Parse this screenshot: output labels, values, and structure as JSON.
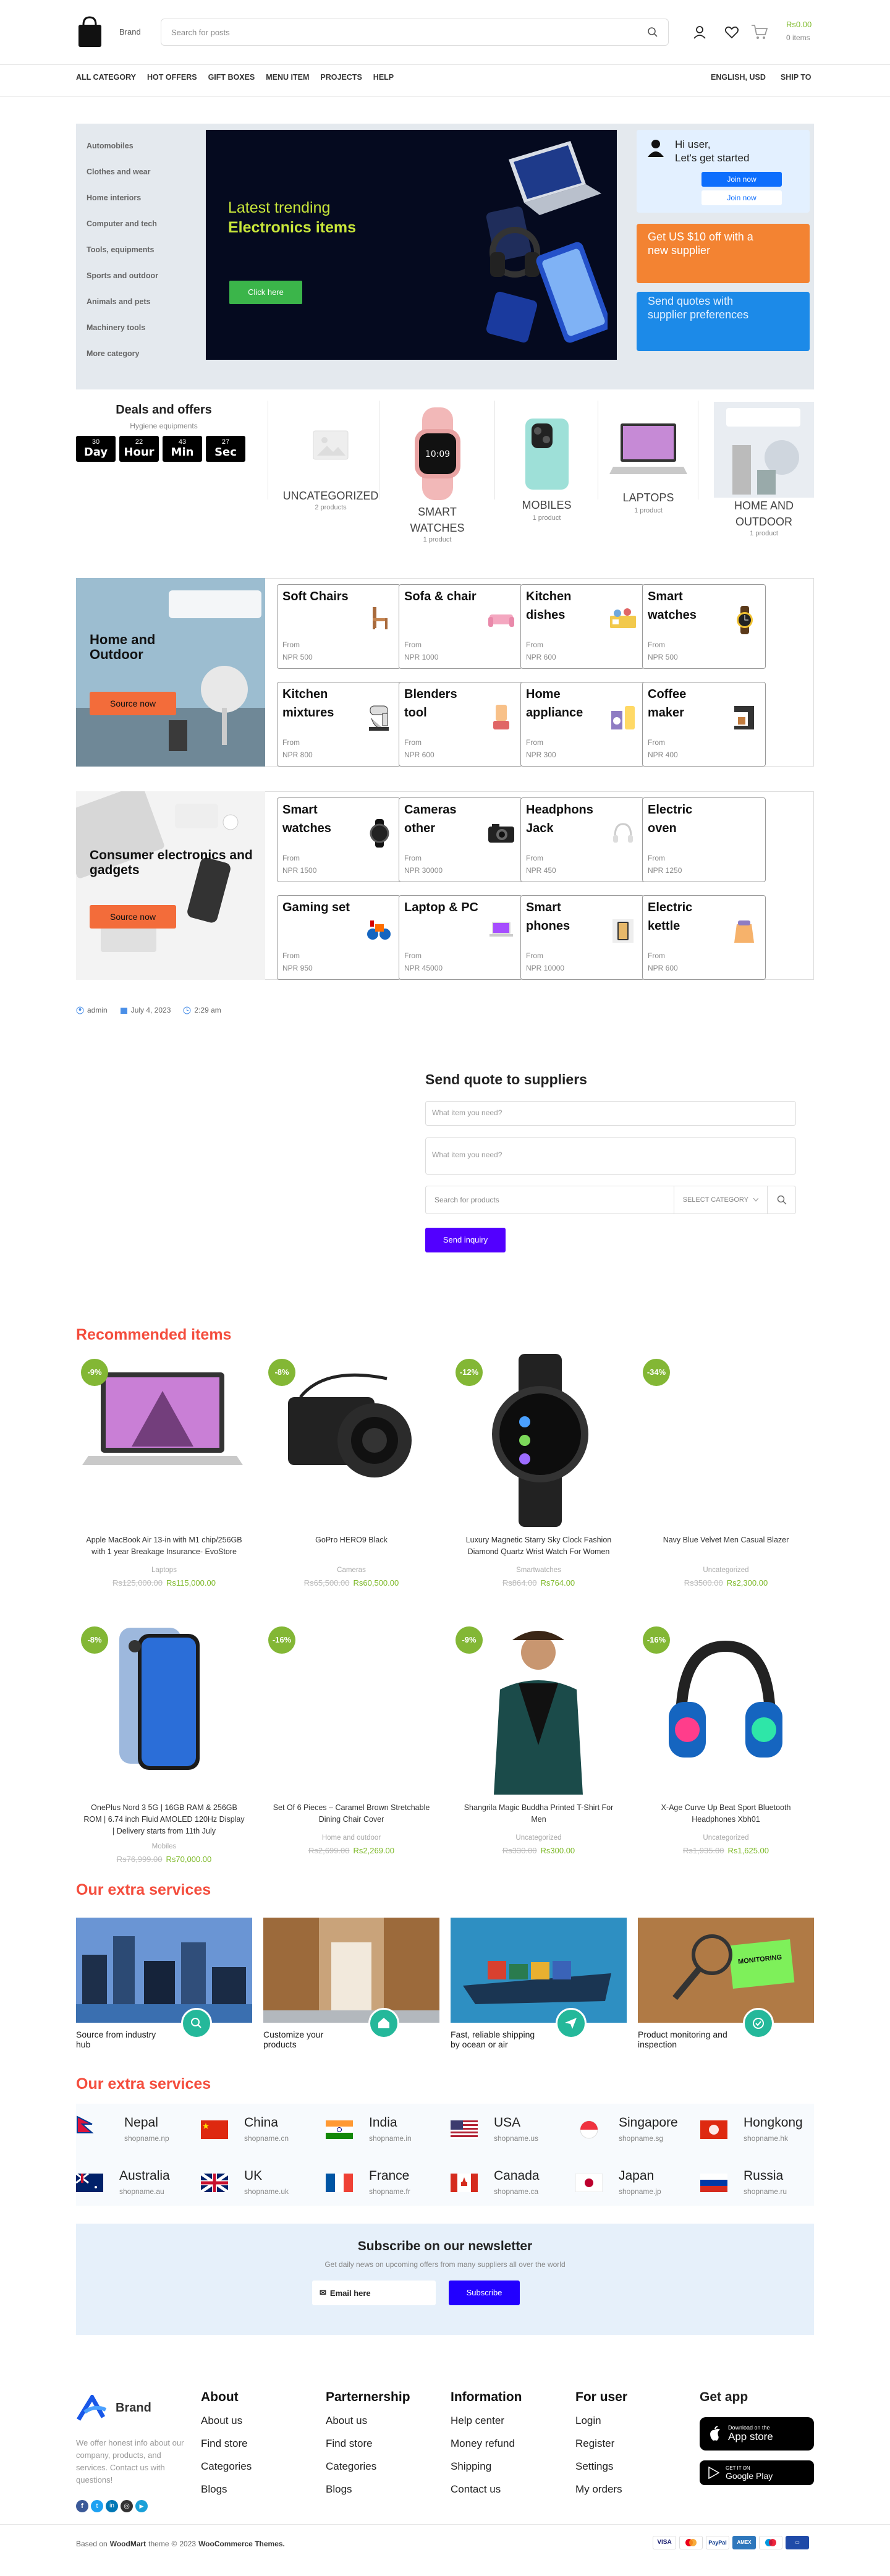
{
  "header": {
    "brand": "Brand",
    "search_placeholder": "Search for posts",
    "cart_price": "Rs0.00",
    "cart_items": "0 items"
  },
  "nav": {
    "items": [
      "ALL CATEGORY",
      "HOT OFFERS",
      "GIFT BOXES",
      "MENU ITEM",
      "PROJECTS",
      "HELP"
    ],
    "lang": "ENGLISH, USD",
    "ship": "SHIP TO"
  },
  "sidebar": [
    "Automobiles",
    "Clothes and wear",
    "Home interiors",
    "Computer and tech",
    "Tools, equipments",
    "Sports and outdoor",
    "Animals and pets",
    "Machinery tools",
    "More category"
  ],
  "hero": {
    "line1": "Latest trending",
    "line2": "Electronics items",
    "cta": "Click here"
  },
  "user_card": {
    "greet1": "Hi user,",
    "greet2": "Let's get started",
    "join": "Join now",
    "login": "Join now"
  },
  "promo_orange": "Get US $10 off with a new supplier",
  "promo_blue": "Send quotes with supplier preferences",
  "deals": {
    "title": "Deals and offers",
    "subtitle": "Hygiene equipments",
    "timer": [
      {
        "n": "30",
        "u": "Day"
      },
      {
        "n": "22",
        "u": "Hour"
      },
      {
        "n": "43",
        "u": "Min"
      },
      {
        "n": "27",
        "u": "Sec"
      }
    ],
    "cats": [
      {
        "name": "UNCATEGORIZED",
        "count": "2 products"
      },
      {
        "name": "SMART WATCHES",
        "count": "1 product"
      },
      {
        "name": "MOBILES",
        "count": "1 product"
      },
      {
        "name": "LAPTOPS",
        "count": "1 product"
      },
      {
        "name": "HOME AND OUTDOOR",
        "count": "1 product"
      }
    ]
  },
  "block1": {
    "title": "Home and Outdoor",
    "cta": "Source now",
    "items": [
      {
        "name": "Soft Chairs",
        "from": "From",
        "price": "NPR 500"
      },
      {
        "name": "Sofa & chair",
        "from": "From",
        "price": "NPR 1000"
      },
      {
        "name": "Kitchen dishes",
        "from": "From",
        "price": "NPR 600"
      },
      {
        "name": "Smart watches",
        "from": "From",
        "price": "NPR 500"
      },
      {
        "name": "Kitchen mixtures",
        "from": "From",
        "price": "NPR 800"
      },
      {
        "name": "Blenders tool",
        "from": "From",
        "price": "NPR 600"
      },
      {
        "name": "Home appliance",
        "from": "From",
        "price": "NPR 300"
      },
      {
        "name": "Coffee maker",
        "from": "From",
        "price": "NPR 400"
      }
    ]
  },
  "block2": {
    "title": "Consumer electronics and gadgets",
    "cta": "Source now",
    "items": [
      {
        "name": "Smart watches",
        "from": "From",
        "price": "NPR 1500"
      },
      {
        "name": "Cameras other",
        "from": "From",
        "price": "NPR 30000"
      },
      {
        "name": "Headphons Jack",
        "from": "From",
        "price": "NPR 450"
      },
      {
        "name": "Electric oven",
        "from": "From",
        "price": "NPR 1250"
      },
      {
        "name": "Gaming set",
        "from": "From",
        "price": "NPR 950"
      },
      {
        "name": "Laptop & PC",
        "from": "From",
        "price": "NPR 45000"
      },
      {
        "name": "Smart phones",
        "from": "From",
        "price": "NPR 10000"
      },
      {
        "name": "Electric kettle",
        "from": "From",
        "price": "NPR 600"
      }
    ]
  },
  "meta": {
    "author": "admin",
    "date": "July 4, 2023",
    "time": "2:29 am"
  },
  "quote": {
    "title": "Send quote to suppliers",
    "field1": "What item you need?",
    "field2": "What item you need?",
    "search": "Search for products",
    "category": "SELECT CATEGORY",
    "button": "Send inquiry"
  },
  "recommended": {
    "title": "Recommended items",
    "items": [
      {
        "badge": "-9%",
        "name": "Apple MacBook Air 13-in with M1 chip/256GB with 1 year Breakage Insurance- EvoStore",
        "cat": "Laptops",
        "old": "Rs125,000.00",
        "new": "Rs115,000.00"
      },
      {
        "badge": "-8%",
        "name": "GoPro HERO9 Black",
        "cat": "Cameras",
        "old": "Rs65,500.00",
        "new": "Rs60,500.00"
      },
      {
        "badge": "-12%",
        "name": "Luxury Magnetic Starry Sky Clock Fashion Diamond Quartz Wrist Watch For Women",
        "cat": "Smartwatches",
        "old": "Rs864.00",
        "new": "Rs764.00"
      },
      {
        "badge": "-34%",
        "name": "Navy Blue Velvet Men Casual Blazer",
        "cat": "Uncategorized",
        "old": "Rs3500.00",
        "new": "Rs2,300.00"
      },
      {
        "badge": "-8%",
        "name": "OnePlus Nord 3 5G | 16GB RAM & 256GB ROM | 6.74 inch Fluid AMOLED 120Hz Display | Delivery starts from 11th July",
        "cat": "Mobiles",
        "old": "Rs76,999.00",
        "new": "Rs70,000.00"
      },
      {
        "badge": "-16%",
        "name": "Set Of 6 Pieces – Caramel Brown Stretchable Dining Chair Cover",
        "cat": "Home and outdoor",
        "old": "Rs2,699.00",
        "new": "Rs2,269.00"
      },
      {
        "badge": "-9%",
        "name": "Shangrila Magic Buddha Printed T-Shirt For Men",
        "cat": "Uncategorized",
        "old": "Rs330.00",
        "new": "Rs300.00"
      },
      {
        "badge": "-16%",
        "name": "X-Age Curve Up Beat Sport Bluetooth Headphones Xbh01",
        "cat": "Uncategorized",
        "old": "Rs1,935.00",
        "new": "Rs1,625.00"
      }
    ]
  },
  "services": {
    "title": "Our extra services",
    "items": [
      {
        "text": "Source from industry hub",
        "icon": "search-icon"
      },
      {
        "text": "Customize your products",
        "icon": "home-icon"
      },
      {
        "text": "Fast, reliable shipping by ocean or air",
        "icon": "send-icon"
      },
      {
        "text": "Product monitoring and inspection",
        "icon": "check-icon"
      }
    ],
    "monitor_label": "MONITORING"
  },
  "regions": {
    "title": "Our extra services",
    "items": [
      {
        "name": "Nepal",
        "site": "shopname.np"
      },
      {
        "name": "China",
        "site": "shopname.cn"
      },
      {
        "name": "India",
        "site": "shopname.in"
      },
      {
        "name": "USA",
        "site": "shopname.us"
      },
      {
        "name": "Singapore",
        "site": "shopname.sg"
      },
      {
        "name": "Hongkong",
        "site": "shopname.hk"
      },
      {
        "name": "Australia",
        "site": "shopname.au"
      },
      {
        "name": "UK",
        "site": "shopname.uk"
      },
      {
        "name": "France",
        "site": "shopname.fr"
      },
      {
        "name": "Canada",
        "site": "shopname.ca"
      },
      {
        "name": "Japan",
        "site": "shopname.jp"
      },
      {
        "name": "Russia",
        "site": "shopname.ru"
      }
    ]
  },
  "newsletter": {
    "title": "Subscribe on our newsletter",
    "subtitle": "Get daily news on upcoming offers from many suppliers all over the world",
    "placeholder": "Email here",
    "button": "Subscribe"
  },
  "footer": {
    "brand": "Brand",
    "about_text": "We offer honest info about our company, products, and services. Contact us with questions!",
    "cols": [
      {
        "title": "About",
        "links": [
          "About us",
          "Find store",
          "Categories",
          "Blogs"
        ]
      },
      {
        "title": "Parternership",
        "links": [
          "About us",
          "Find store",
          "Categories",
          "Blogs"
        ]
      },
      {
        "title": "Information",
        "links": [
          "Help center",
          "Money refund",
          "Shipping",
          "Contact us"
        ]
      },
      {
        "title": "For user",
        "links": [
          "Login",
          "Register",
          "Settings",
          "My orders"
        ]
      }
    ],
    "app_title": "Get app",
    "app_store_small": "Download on the",
    "app_store": "App store",
    "gplay_small": "GET IT ON",
    "gplay": "Google Play",
    "bottom_pre": "Based on",
    "bottom_woodmart": "WoodMart",
    "bottom_mid": "theme",
    "bottom_year": "2023",
    "bottom_wc": "WooCommerce Themes."
  }
}
